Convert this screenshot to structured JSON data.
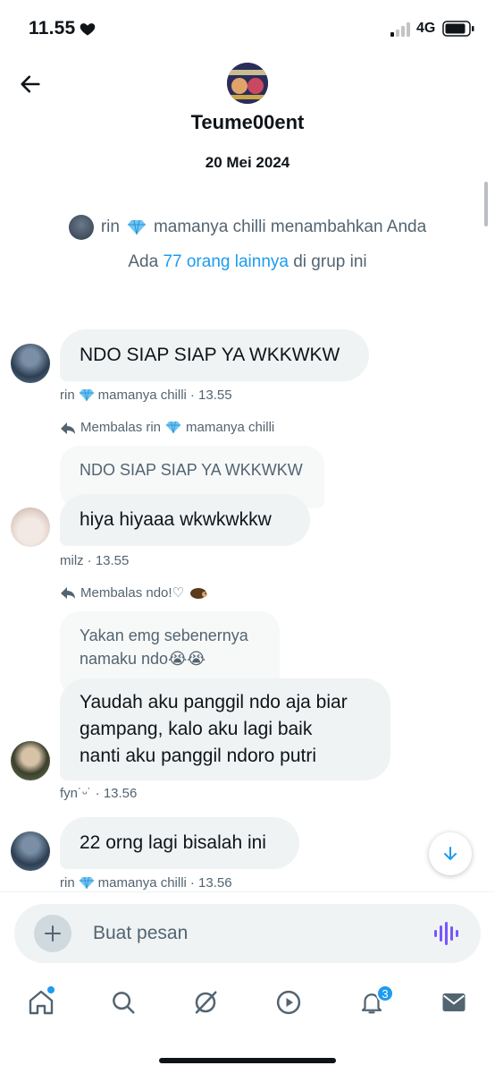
{
  "status": {
    "time": "11.55",
    "network": "4G"
  },
  "header": {
    "group_name": "Teume00ent",
    "date": "20 Mei 2024"
  },
  "system_note": {
    "actor": "rin",
    "actor_suffix": "mamanya chilli menambahkan Anda",
    "line2_prefix": "Ada",
    "line2_link": "77 orang lainnya",
    "line2_suffix": "di grup ini"
  },
  "messages": [
    {
      "text": "NDO SIAP SIAP YA WKKWKW",
      "sender": "rin",
      "sender_suffix": "mamanya chilli",
      "time": "· 13.55"
    },
    {
      "reply_label": "Membalas rin",
      "reply_target_suffix": "mamanya chilli",
      "quoted": "NDO SIAP SIAP YA WKKWKW",
      "text": "hiya hiyaaa wkwkwkkw",
      "sender": "milz",
      "time": "· 13.55"
    },
    {
      "reply_label": "Membalas ndo!♡",
      "quoted_line1": "Yakan emg sebenernya",
      "quoted_line2": "namaku ndo😭😭",
      "text_line1": "Yaudah aku panggil ndo aja biar",
      "text_line2": "gampang, kalo aku lagi baik",
      "text_line3": "nanti aku panggil ndoro putri",
      "sender": "fyn˙ᵕ˙",
      "time": "· 13.56"
    },
    {
      "text": "22 orng lagi bisalah ini",
      "sender": "rin",
      "sender_suffix": "mamanya chilli",
      "time": "· 13.56"
    }
  ],
  "composer": {
    "placeholder": "Buat pesan"
  },
  "tabbar": {
    "notification_count": "3"
  },
  "colors": {
    "accent": "#1d9bf0",
    "bubble": "#eff3f4",
    "muted": "#536471"
  },
  "icons": [
    "heart-icon",
    "signal-icon",
    "battery-icon",
    "back-arrow-icon",
    "gem-icon",
    "reply-arrow-icon",
    "hedgehog-icon",
    "arrow-down-icon",
    "plus-icon",
    "voice-icon",
    "home-icon",
    "search-icon",
    "grok-icon",
    "play-icon",
    "bell-icon",
    "mail-icon"
  ]
}
